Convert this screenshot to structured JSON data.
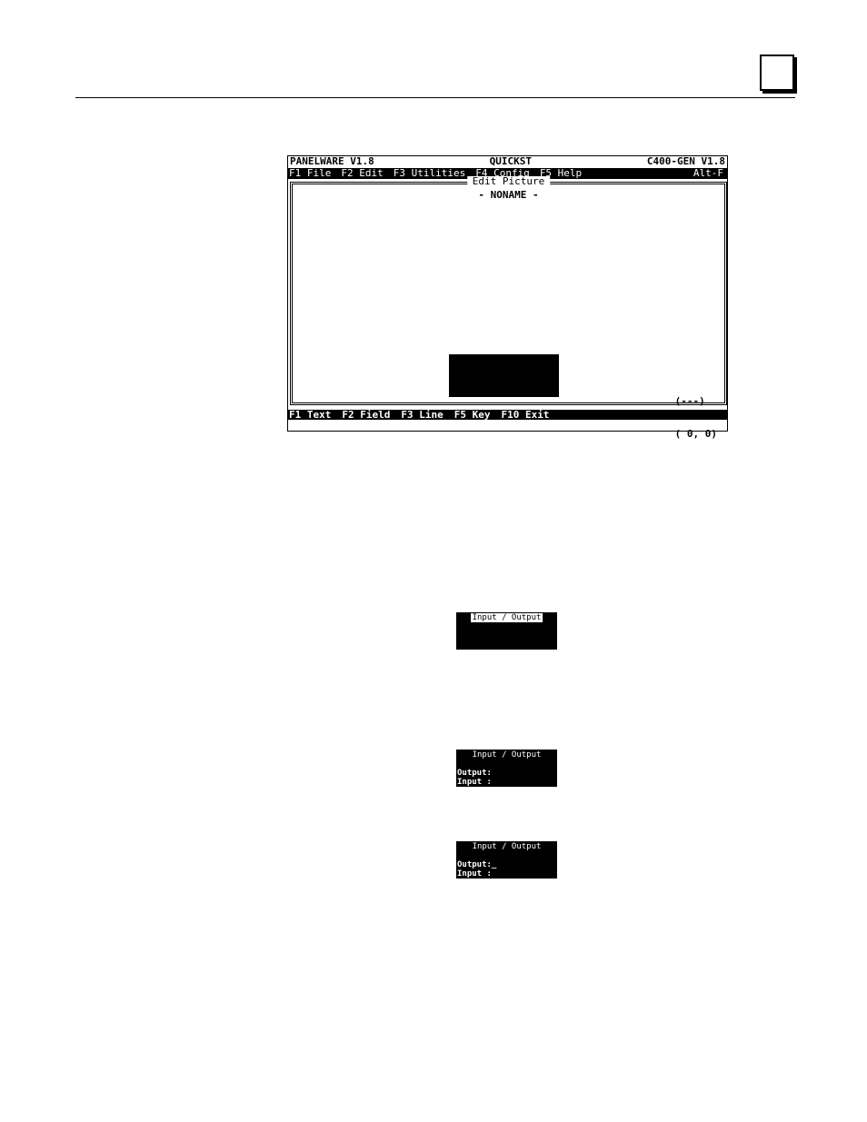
{
  "screen": {
    "app_name": "PANELWARE V1.8",
    "project": "QUICKST",
    "device": "C400-GEN V1.8",
    "menu": [
      {
        "label": "F1 File"
      },
      {
        "label": "F2 Edit"
      },
      {
        "label": "F3 Utilities"
      },
      {
        "label": "F4 Config"
      },
      {
        "label": "F5 Help"
      }
    ],
    "menu_hotkey": "Alt-F",
    "edit_area_title": "Edit Picture",
    "document_name": "- NONAME -",
    "mode_indicator": "(---)",
    "cursor_position": "( 0, 0)",
    "function_keys": [
      {
        "label": "F1 Text"
      },
      {
        "label": "F2 Field"
      },
      {
        "label": "F3 Line"
      },
      {
        "label": "F5 Key"
      },
      {
        "label": "F10 Exit"
      }
    ]
  },
  "mini_windows": [
    {
      "title": "Input / Output",
      "lines": []
    },
    {
      "title": "Input / Output",
      "lines": [
        "Output:",
        "Input :"
      ]
    },
    {
      "title": "Input / Output",
      "lines": [
        "Output:_",
        "Input :"
      ]
    }
  ]
}
